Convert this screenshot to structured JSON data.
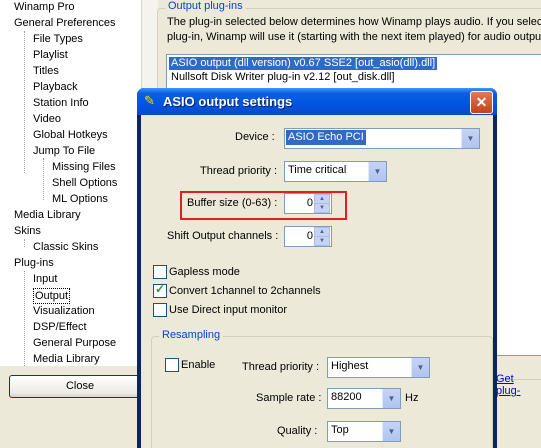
{
  "tree": {
    "items": [
      "Winamp Pro",
      "General Preferences",
      "File Types",
      "Playlist",
      "Titles",
      "Playback",
      "Station Info",
      "Video",
      "Global Hotkeys",
      "Jump To File",
      "Missing Files",
      "Shell Options",
      "ML Options",
      "Media Library",
      "Skins",
      "Classic Skins",
      "Plug-ins",
      "Input",
      "Output",
      "Visualization",
      "DSP/Effect",
      "General Purpose",
      "Media Library"
    ]
  },
  "close_button": "Close",
  "output": {
    "group_title": "Output plug-ins",
    "desc_line1": "The plug-in selected below determines how Winamp plays audio. If you select",
    "desc_line2": "plug-in, Winamp will use it (starting with the next item played) for audio outpu",
    "plugins": [
      "ASIO output (dll version) v0.67 SSE2   [out_asio(dll).dll]",
      "Nullsoft Disk Writer plug-in v2.12   [out_disk.dll]"
    ],
    "get_link": "Get plug-"
  },
  "dialog": {
    "title": "ASIO output settings",
    "close_glyph": "✕",
    "device_label": "Device :",
    "device_value": "ASIO Echo PCI",
    "thread_label": "Thread priority :",
    "thread_value": "Time critical",
    "buffer_label": "Buffer size (0-63) :",
    "buffer_value": "0",
    "shift_label": "Shift Output channels :",
    "shift_value": "0",
    "gapless_label": "Gapless mode",
    "convert_label": "Convert 1channel to 2channels",
    "direct_label": "Use Direct input monitor",
    "resampling": {
      "title": "Resampling",
      "enable_label": "Enable",
      "thread_label": "Thread priority :",
      "thread_value": "Highest",
      "rate_label": "Sample rate :",
      "rate_value": "88200",
      "rate_unit": "Hz",
      "quality_label": "Quality :",
      "quality_value": "Top"
    }
  },
  "checkbox_states": {
    "gapless": false,
    "convert": true,
    "direct": false,
    "enable": false
  },
  "colors": {
    "highlight": "#e02020",
    "selection": "#316ac5",
    "titlebar": "#0054e3"
  }
}
